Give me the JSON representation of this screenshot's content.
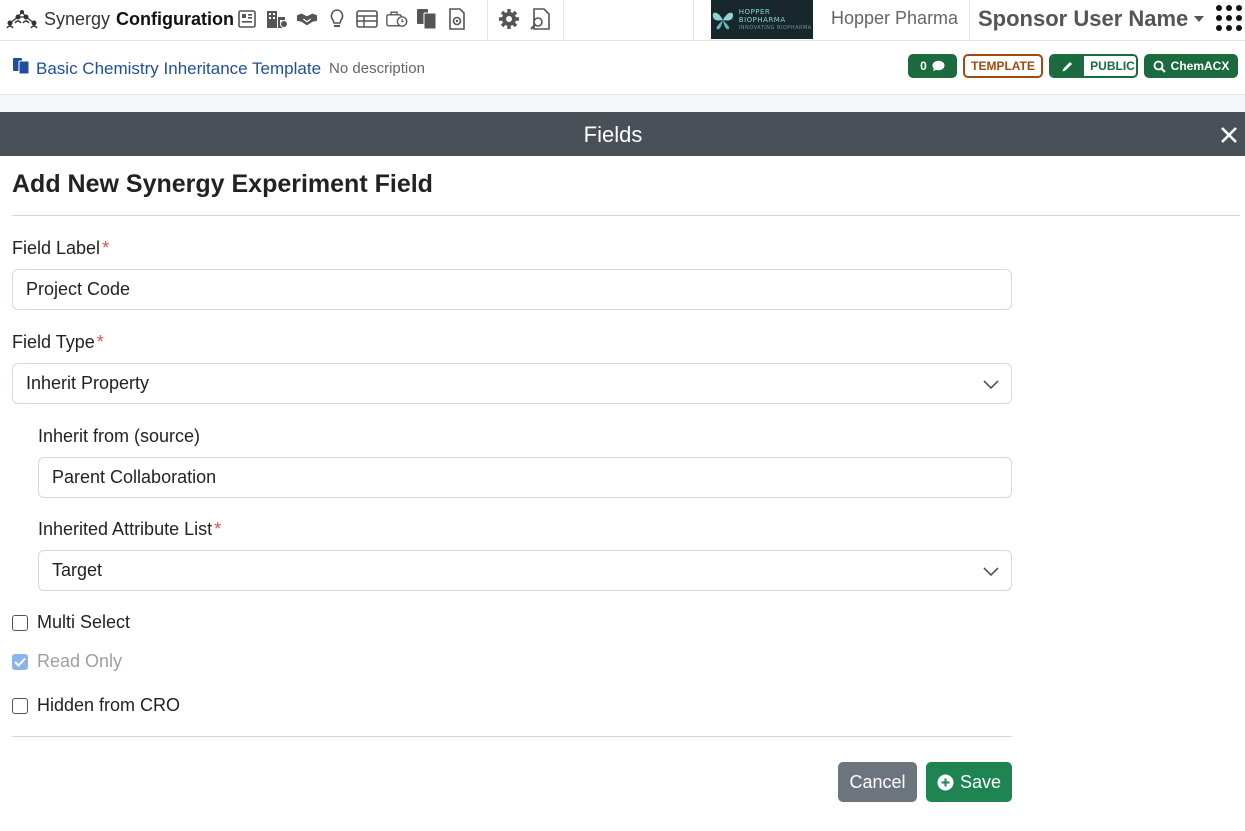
{
  "nav": {
    "app_name": "Synergy",
    "section_name": "Configuration",
    "org_logo_line1": "HOPPER BIOPHARMA",
    "org_logo_line2": "INNOVATING BIOPHARMA",
    "org_name": "Hopper Pharma",
    "user_name": "Sponsor User Name",
    "icons": [
      "dashboard-icon",
      "buildings-icon",
      "handshake-icon",
      "lightbulb-icon",
      "table-icon",
      "toolbox-clock-icon",
      "copy-documents-icon",
      "document-settings-icon"
    ],
    "icons2": [
      "gear-icon",
      "document-search-icon"
    ]
  },
  "template": {
    "title": "Basic Chemistry Inheritance Template",
    "description": "No description",
    "comment_count": "0",
    "template_badge": "TEMPLATE",
    "public_badge": "PUBLIC",
    "chem_badge": "ChemACX"
  },
  "modal": {
    "title": "Fields"
  },
  "form": {
    "heading": "Add New Synergy Experiment Field",
    "field_label": {
      "label": "Field Label",
      "value": "Project Code"
    },
    "field_type": {
      "label": "Field Type",
      "value": "Inherit Property"
    },
    "inherit_from": {
      "label": "Inherit from (source)",
      "value": "Parent Collaboration"
    },
    "attribute_list": {
      "label": "Inherited Attribute List",
      "value": "Target"
    },
    "required_mark": "*",
    "multi_select": {
      "label": "Multi Select",
      "checked": false
    },
    "read_only": {
      "label": "Read Only",
      "checked": true
    },
    "hidden_from_cro": {
      "label": "Hidden from CRO",
      "checked": false
    },
    "cancel_label": "Cancel",
    "save_label": "Save"
  },
  "colors": {
    "primary_green": "#1c6b3f",
    "template_brown": "#a04a12",
    "modal_header": "#495057",
    "link_blue": "#1f4e9c",
    "required_red": "#d9534f"
  }
}
